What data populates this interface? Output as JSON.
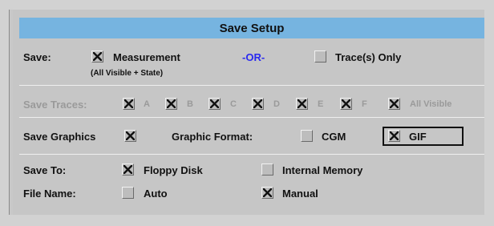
{
  "dialog": {
    "title": "Save Setup"
  },
  "save": {
    "label": "Save:",
    "measurement": {
      "label": "Measurement",
      "checked": true
    },
    "measurement_note": "(All Visible + State)",
    "or_text": "-OR-",
    "traces_only": {
      "label": "Trace(s) Only",
      "checked": false
    }
  },
  "save_traces": {
    "label": "Save Traces:",
    "items": [
      {
        "label": "A",
        "checked": true
      },
      {
        "label": "B",
        "checked": true
      },
      {
        "label": "C",
        "checked": true
      },
      {
        "label": "D",
        "checked": true
      },
      {
        "label": "E",
        "checked": true
      },
      {
        "label": "F",
        "checked": true
      },
      {
        "label": "All Visible",
        "checked": true
      }
    ]
  },
  "save_graphics": {
    "label": "Save Graphics",
    "checked": true,
    "format_label": "Graphic Format:",
    "cgm": {
      "label": "CGM",
      "checked": false
    },
    "gif": {
      "label": "GIF",
      "checked": true
    }
  },
  "save_to": {
    "label": "Save To:",
    "floppy": {
      "label": "Floppy Disk",
      "checked": true
    },
    "internal": {
      "label": "Internal Memory",
      "checked": false
    }
  },
  "file_name": {
    "label": "File Name:",
    "auto": {
      "label": "Auto",
      "checked": false
    },
    "manual": {
      "label": "Manual",
      "checked": true
    }
  },
  "colors": {
    "title_bar": "#76b4e0",
    "or_text": "#2a2af0",
    "disabled_text": "#9a9a9a"
  }
}
